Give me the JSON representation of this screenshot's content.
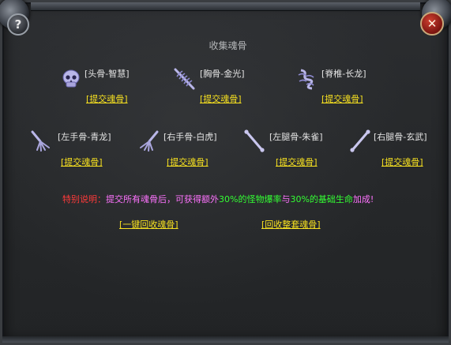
{
  "title": "收集魂骨",
  "close_icon": "close-icon",
  "help_icon": "help-icon",
  "bones": [
    {
      "name": "[头骨-智慧]",
      "icon": "skull-icon",
      "action": "[提交魂骨]"
    },
    {
      "name": "[胸骨-金光]",
      "icon": "ribcage-icon",
      "action": "[提交魂骨]"
    },
    {
      "name": "[脊椎-长龙]",
      "icon": "spine-icon",
      "action": "[提交魂骨]"
    },
    {
      "name": "[左手骨-青龙]",
      "icon": "hand-bone-icon",
      "action": "[提交魂骨]"
    },
    {
      "name": "[右手骨-白虎]",
      "icon": "hand-bone-icon",
      "action": "[提交魂骨]"
    },
    {
      "name": "[左腿骨-朱雀]",
      "icon": "leg-bone-icon",
      "action": "[提交魂骨]"
    },
    {
      "name": "[右腿骨-玄武]",
      "icon": "leg-bone-icon",
      "action": "[提交魂骨]"
    }
  ],
  "note": {
    "label": "特别说明：",
    "part1": "提交所有魂骨后，可获得额外",
    "pct1": "30%",
    "part2": "的怪物爆率",
    "part3": "与",
    "pct2": "30%",
    "part4": "的基础生命",
    "part5": "加成!"
  },
  "actions": {
    "recycle_one_click": "[一键回收魂骨]",
    "recycle_full_set": "[回收整套魂骨]"
  },
  "colors": {
    "link": "#f6e020",
    "note_label": "#ff3a3a",
    "note_text": "#ff73ff",
    "highlight": "#33ff33"
  }
}
